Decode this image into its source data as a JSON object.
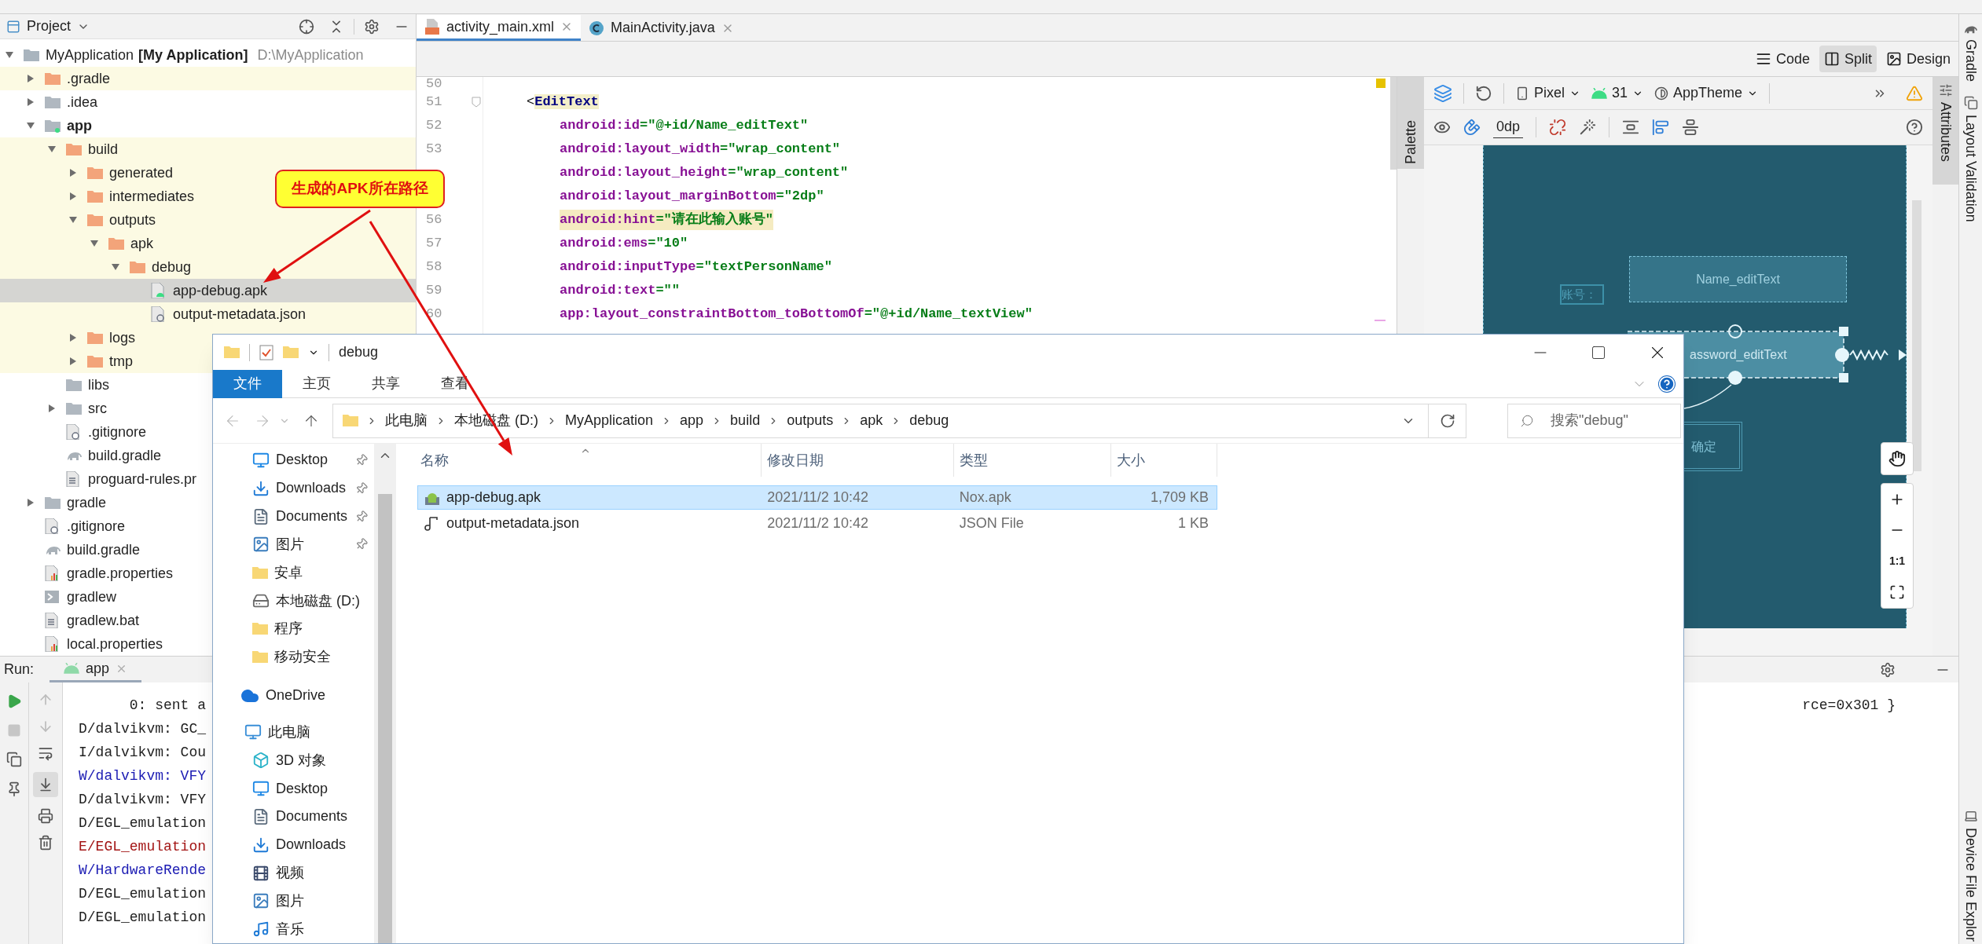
{
  "project_panel": {
    "title": "Project",
    "tree": [
      {
        "label": "MyApplication",
        "suffix": "[My Application]",
        "path": "D:\\MyApplication",
        "kind": "project",
        "expanded": true,
        "excluded": false,
        "selected": false,
        "children": [
          {
            "label": ".gradle",
            "kind": "build",
            "expanded": false,
            "excluded": true,
            "selected": false
          },
          {
            "label": ".idea",
            "kind": "folder",
            "expanded": false,
            "excluded": false,
            "selected": false
          },
          {
            "label": "app",
            "kind": "module",
            "expanded": true,
            "excluded": false,
            "selected": false,
            "children": [
              {
                "label": "build",
                "kind": "build",
                "expanded": true,
                "excluded": true,
                "selected": false,
                "children": [
                  {
                    "label": "generated",
                    "kind": "build",
                    "expanded": false,
                    "excluded": true,
                    "selected": false
                  },
                  {
                    "label": "intermediates",
                    "kind": "build",
                    "expanded": false,
                    "excluded": true,
                    "selected": false
                  },
                  {
                    "label": "outputs",
                    "kind": "build",
                    "expanded": true,
                    "excluded": true,
                    "selected": false,
                    "children": [
                      {
                        "label": "apk",
                        "kind": "build",
                        "expanded": true,
                        "excluded": true,
                        "selected": false,
                        "children": [
                          {
                            "label": "debug",
                            "kind": "build",
                            "expanded": true,
                            "excluded": true,
                            "selected": false,
                            "children": [
                              {
                                "label": "app-debug.apk",
                                "kind": "apk",
                                "excluded": true,
                                "selected": true
                              },
                              {
                                "label": "output-metadata.json",
                                "kind": "json",
                                "excluded": true,
                                "selected": false
                              }
                            ]
                          }
                        ]
                      }
                    ]
                  },
                  {
                    "label": "logs",
                    "kind": "build",
                    "expanded": false,
                    "excluded": true,
                    "selected": false
                  },
                  {
                    "label": "tmp",
                    "kind": "build",
                    "expanded": false,
                    "excluded": true,
                    "selected": false
                  }
                ]
              },
              {
                "label": "libs",
                "kind": "folder",
                "excluded": false,
                "selected": false
              },
              {
                "label": "src",
                "kind": "folder",
                "expanded": false,
                "excluded": false,
                "selected": false
              },
              {
                "label": ".gitignore",
                "kind": "ignore",
                "excluded": false,
                "selected": false
              },
              {
                "label": "build.gradle",
                "kind": "gradle",
                "excluded": false,
                "selected": false
              },
              {
                "label": "proguard-rules.pr",
                "kind": "text",
                "excluded": false,
                "selected": false
              }
            ]
          },
          {
            "label": "gradle",
            "kind": "folder",
            "expanded": false,
            "excluded": false,
            "selected": false
          },
          {
            "label": ".gitignore",
            "kind": "ignore",
            "excluded": false,
            "selected": false
          },
          {
            "label": "build.gradle",
            "kind": "gradle",
            "excluded": false,
            "selected": false
          },
          {
            "label": "gradle.properties",
            "kind": "properties",
            "excluded": false,
            "selected": false
          },
          {
            "label": "gradlew",
            "kind": "script",
            "excluded": false,
            "selected": false
          },
          {
            "label": "gradlew.bat",
            "kind": "text",
            "excluded": false,
            "selected": false
          },
          {
            "label": "local.properties",
            "kind": "properties",
            "excluded": false,
            "selected": false
          }
        ]
      }
    ]
  },
  "editor_tabs": [
    {
      "label": "activity_main.xml",
      "kind": "xml",
      "selected": true
    },
    {
      "label": "MainActivity.java",
      "kind": "java",
      "selected": false
    }
  ],
  "view_modes": [
    {
      "label": "Code",
      "kind": "code",
      "selected": false
    },
    {
      "label": "Split",
      "kind": "split",
      "selected": true
    },
    {
      "label": "Design",
      "kind": "design",
      "selected": false
    }
  ],
  "code": [
    {
      "number": "50"
    },
    {
      "number": "51",
      "parts": [
        {
          "text": "<",
          "kind": "punct"
        },
        {
          "text": "EditText",
          "kind": "tag"
        }
      ],
      "children": [
        {
          "number": "52",
          "highlighted": false,
          "parts": [
            {
              "text": "android:id",
              "kind": "attr"
            },
            {
              "text": "=\"@+id/Name_editText\"",
              "kind": "value"
            }
          ]
        },
        {
          "number": "53",
          "highlighted": false,
          "parts": [
            {
              "text": "android:layout_width",
              "kind": "attr"
            },
            {
              "text": "=\"wrap_content\"",
              "kind": "value"
            }
          ]
        },
        {
          "highlighted": false,
          "parts": [
            {
              "text": "android:layout_height",
              "kind": "attr"
            },
            {
              "text": "=\"wrap_content\"",
              "kind": "value"
            }
          ]
        },
        {
          "highlighted": false,
          "parts": [
            {
              "text": "android:layout_marginBottom",
              "kind": "attr"
            },
            {
              "text": "=\"2dp\"",
              "kind": "value"
            }
          ]
        },
        {
          "number": "56",
          "highlighted": true,
          "parts": [
            {
              "text": "android:hint",
              "kind": "attr"
            },
            {
              "text": "=\"请在此输入账号\"",
              "kind": "value"
            }
          ]
        },
        {
          "number": "57",
          "highlighted": false,
          "parts": [
            {
              "text": "android:ems",
              "kind": "attr"
            },
            {
              "text": "=\"10\"",
              "kind": "value"
            }
          ]
        },
        {
          "number": "58",
          "highlighted": false,
          "parts": [
            {
              "text": "android:inputType",
              "kind": "attr"
            },
            {
              "text": "=\"textPersonName\"",
              "kind": "value"
            }
          ]
        },
        {
          "number": "59",
          "highlighted": false,
          "parts": [
            {
              "text": "android:text",
              "kind": "attr"
            },
            {
              "text": "=\"\"",
              "kind": "value"
            }
          ]
        },
        {
          "number": "60",
          "highlighted": false,
          "parts": [
            {
              "text": "app:layout_constraintBottom_toBottomOf",
              "kind": "attr"
            },
            {
              "text": "=\"@+id/Name_textView\"",
              "kind": "value"
            }
          ]
        }
      ]
    }
  ],
  "design": {
    "side_tab": "Palette",
    "attributes_tab": "Attributes",
    "device": "Pixel",
    "api": "31",
    "theme": "AppTheme",
    "margin": "0dp",
    "blueprint": {
      "label": "账号：",
      "name_field": "Name_editText",
      "password_field": "assword_editText",
      "button": "确定"
    },
    "zoom_actual": "1:1"
  },
  "right_strip": {
    "top": [
      "Gradle",
      "Layout Validation"
    ],
    "bottom": "Device File Explor"
  },
  "run_panel": {
    "title": "Run:",
    "tabs": [
      {
        "label": "app",
        "selected": true
      }
    ],
    "lines": [
      {
        "text": "      0: sent a",
        "kind": "debug",
        "tail": "rce=0x301 }"
      },
      {
        "text": "D/dalvikvm: GC_",
        "kind": "debug"
      },
      {
        "text": "I/dalvikvm: Cou",
        "kind": "info"
      },
      {
        "text": "W/dalvikvm: VFY",
        "kind": "warn"
      },
      {
        "text": "D/dalvikvm: VFY",
        "kind": "debug"
      },
      {
        "text": "D/EGL_emulation",
        "kind": "debug"
      },
      {
        "text": "E/EGL_emulation",
        "kind": "error"
      },
      {
        "text": "W/HardwareRende",
        "kind": "warn"
      },
      {
        "text": "D/EGL_emulation",
        "kind": "debug"
      },
      {
        "text": "D/EGL_emulation",
        "kind": "debug"
      }
    ]
  },
  "explorer": {
    "title": "debug",
    "ribbon_tabs": [
      {
        "label": "文件",
        "selected": true
      },
      {
        "label": "主页",
        "selected": false
      },
      {
        "label": "共享",
        "selected": false
      },
      {
        "label": "查看",
        "selected": false
      }
    ],
    "breadcrumb": [
      "此电脑",
      "本地磁盘 (D:)",
      "MyApplication",
      "app",
      "build",
      "outputs",
      "apk",
      "debug"
    ],
    "search": {
      "placeholder": "搜索\"debug\""
    },
    "quick_access": [
      {
        "label": "Desktop",
        "kind": "desktop",
        "pinned": true
      },
      {
        "label": "Downloads",
        "kind": "downloads",
        "pinned": true
      },
      {
        "label": "Documents",
        "kind": "documents",
        "pinned": true
      },
      {
        "label": "图片",
        "kind": "pictures",
        "pinned": true
      },
      {
        "label": "安卓",
        "kind": "folder",
        "pinned": false
      },
      {
        "label": "本地磁盘 (D:)",
        "kind": "drive",
        "pinned": false
      },
      {
        "label": "程序",
        "kind": "folder",
        "pinned": false
      },
      {
        "label": "移动安全",
        "kind": "folder",
        "pinned": false
      }
    ],
    "onedrive": "OneDrive",
    "this_pc": {
      "label": "此电脑",
      "children": [
        {
          "label": "3D 对象",
          "kind": "objects"
        },
        {
          "label": "Desktop",
          "kind": "desktop"
        },
        {
          "label": "Documents",
          "kind": "documents"
        },
        {
          "label": "Downloads",
          "kind": "downloads"
        },
        {
          "label": "视频",
          "kind": "videos"
        },
        {
          "label": "图片",
          "kind": "pictures"
        },
        {
          "label": "音乐",
          "kind": "music"
        }
      ]
    },
    "columns": [
      "名称",
      "修改日期",
      "类型",
      "大小"
    ],
    "files": [
      {
        "name": "app-debug.apk",
        "kind": "apk",
        "modified": "2021/11/2 10:42",
        "type": "Nox.apk",
        "size": "1,709 KB",
        "selected": true
      },
      {
        "name": "output-metadata.json",
        "kind": "json",
        "modified": "2021/11/2 10:42",
        "type": "JSON File",
        "size": "1 KB",
        "selected": false
      }
    ]
  },
  "annotation": "生成的APK所在路径"
}
